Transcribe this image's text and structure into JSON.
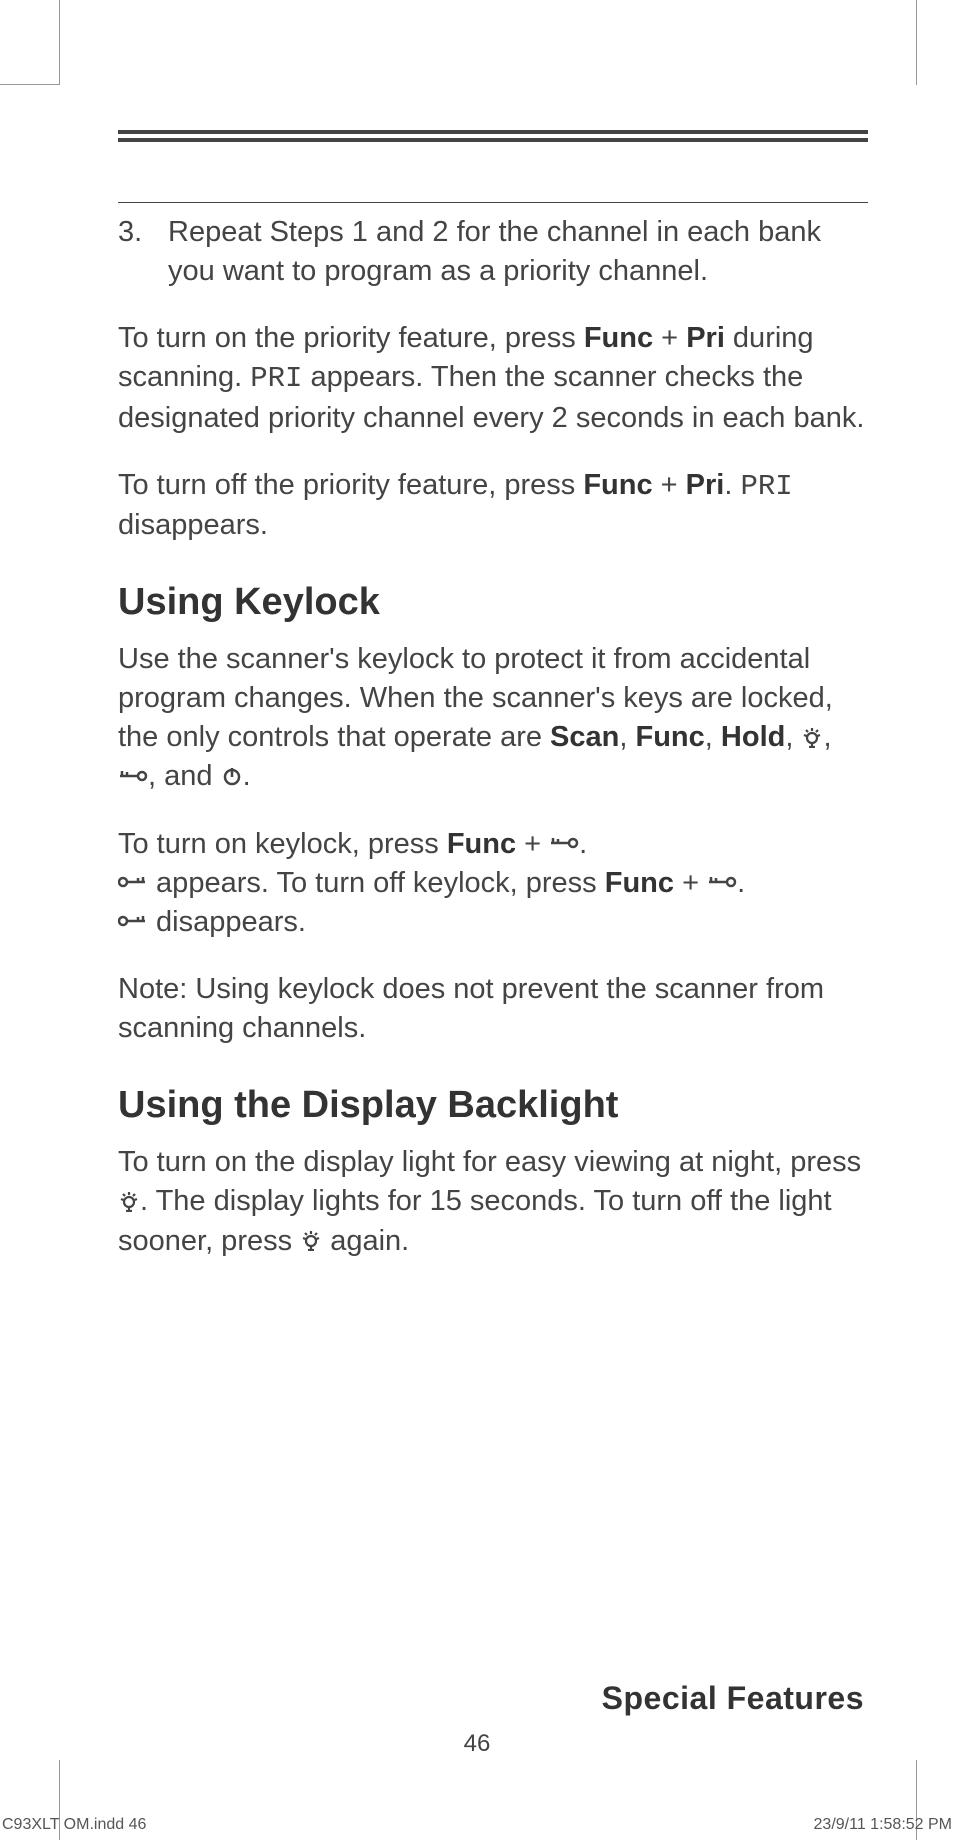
{
  "list": {
    "num3": "3.",
    "item3": "Repeat Steps 1 and 2 for the channel in each bank you want to program as a priority channel."
  },
  "p1": {
    "a": "To turn on the priority feature, press ",
    "func": "Func",
    "plus": " + ",
    "pri": "Pri",
    "b": " during scanning. ",
    "pri_mono": "PRI",
    "c": " appears. Then the scanner checks the designated priority channel every 2 seconds in each bank."
  },
  "p2": {
    "a": "To turn off the priority feature, press ",
    "func": "Func",
    "plus": " + ",
    "pri": "Pri",
    "b": ". ",
    "pri_mono": "PRI",
    "c": " disappears."
  },
  "h_keylock": "Using Keylock",
  "p3": {
    "a": "Use the scanner's keylock to protect it from accidental program changes. When the scanner's keys are locked, the only controls that operate are ",
    "scan": "Scan",
    "c1": ", ",
    "func": "Func",
    "c2": ", ",
    "hold": "Hold",
    "c3": ", ",
    "c4": ", ",
    "c5": ", and ",
    "c6": "."
  },
  "p4": {
    "a": "To turn on keylock, press ",
    "func": "Func",
    "plus": " + ",
    "b": ". ",
    "c": " appears. To turn off keylock, press ",
    "func2": "Func",
    "plus2": " + ",
    "d": ". ",
    "e": " disappears."
  },
  "p5": "Note: Using keylock does not prevent the scanner from scanning channels.",
  "h_backlight": "Using the Display Backlight",
  "p6": {
    "a": "To turn on the display light for easy viewing at night, press ",
    "b": ". The display lights for 15 seconds. To turn off the light sooner, press ",
    "c": " again."
  },
  "section": "Special Features",
  "page_num": "46",
  "footer_left": "C93XLT OM.indd   46",
  "footer_right": "23/9/11   1:58:52 PM"
}
